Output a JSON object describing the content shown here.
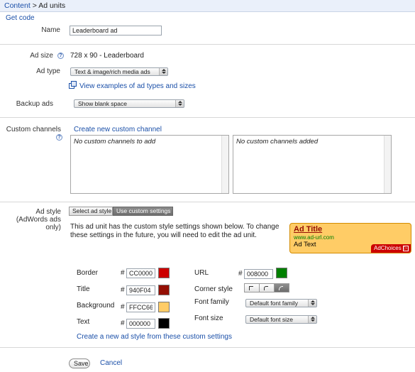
{
  "breadcrumb": {
    "root": "Content",
    "separator": ">",
    "current": "Ad units"
  },
  "get_code": "Get code",
  "name": {
    "label": "Name",
    "value": "Leaderboard ad"
  },
  "ad_size": {
    "label": "Ad size",
    "value": "728 x 90 - Leaderboard"
  },
  "ad_type": {
    "label": "Ad type",
    "selected": "Text & image/rich media ads",
    "examples_link": "View examples of ad types and sizes"
  },
  "backup_ads": {
    "label": "Backup ads",
    "selected": "Show blank space"
  },
  "custom_channels": {
    "label": "Custom channels",
    "create_link": "Create new custom channel",
    "available_empty": "No custom channels to add",
    "added_empty": "No custom channels added"
  },
  "ad_style": {
    "label_line1": "Ad style",
    "label_line2": "(AdWords ads",
    "label_line3": "only)",
    "tab_select": "Select ad style",
    "tab_custom": "Use custom settings",
    "notice": "This ad unit has the custom style settings shown below. To change these settings in the future, you will need to edit the ad unit.",
    "preview": {
      "title": "Ad Title",
      "url": "www.ad-url.com",
      "text": "Ad Text",
      "adchoices": "AdChoices"
    }
  },
  "colors": {
    "hash": "#",
    "border": {
      "label": "Border",
      "value": "CC0000",
      "swatch": "#CC0000"
    },
    "title": {
      "label": "Title",
      "value": "940F04",
      "swatch": "#940F04"
    },
    "background": {
      "label": "Background",
      "value": "FFCC66",
      "swatch": "#FFCC66"
    },
    "text": {
      "label": "Text",
      "value": "000000",
      "swatch": "#000000"
    },
    "url": {
      "label": "URL",
      "value": "008000",
      "swatch": "#008000"
    }
  },
  "corner_style": {
    "label": "Corner style"
  },
  "font_family": {
    "label": "Font family",
    "selected": "Default font family"
  },
  "font_size": {
    "label": "Font size",
    "selected": "Default font size"
  },
  "create_style_link": "Create a new ad style from these custom settings",
  "footer": {
    "save": "Save",
    "cancel": "Cancel"
  }
}
